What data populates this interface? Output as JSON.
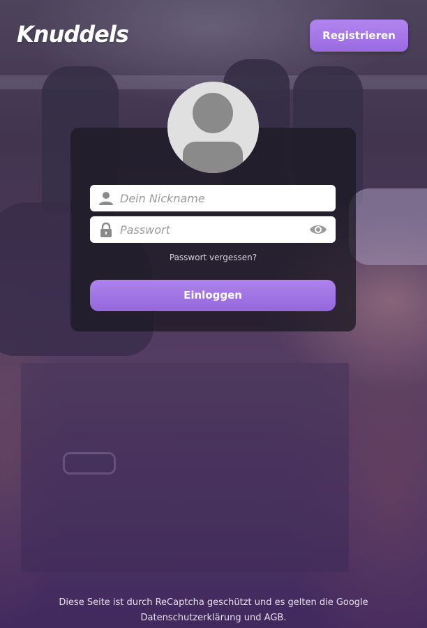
{
  "header": {
    "logo_text": "Knuddels",
    "register_label": "Registrieren"
  },
  "login": {
    "nickname_placeholder": "Dein Nickname",
    "password_placeholder": "Passwort",
    "forgot_password": "Passwort vergessen?",
    "login_label": "Einloggen"
  },
  "footer": {
    "recaptcha_text": "Diese Seite ist durch ReCaptcha geschützt und es gelten die Google",
    "privacy_link": "Datenschutzerklärung",
    "and_text": "und",
    "terms_link": "AGB",
    "period": "."
  },
  "icons": {
    "user": "user-icon",
    "lock": "lock-icon",
    "eye": "eye-icon",
    "avatar": "avatar-placeholder-icon"
  },
  "colors": {
    "accent": "#a477e6",
    "card": "#1c1a24",
    "icon_gray": "#8a8a8a"
  }
}
